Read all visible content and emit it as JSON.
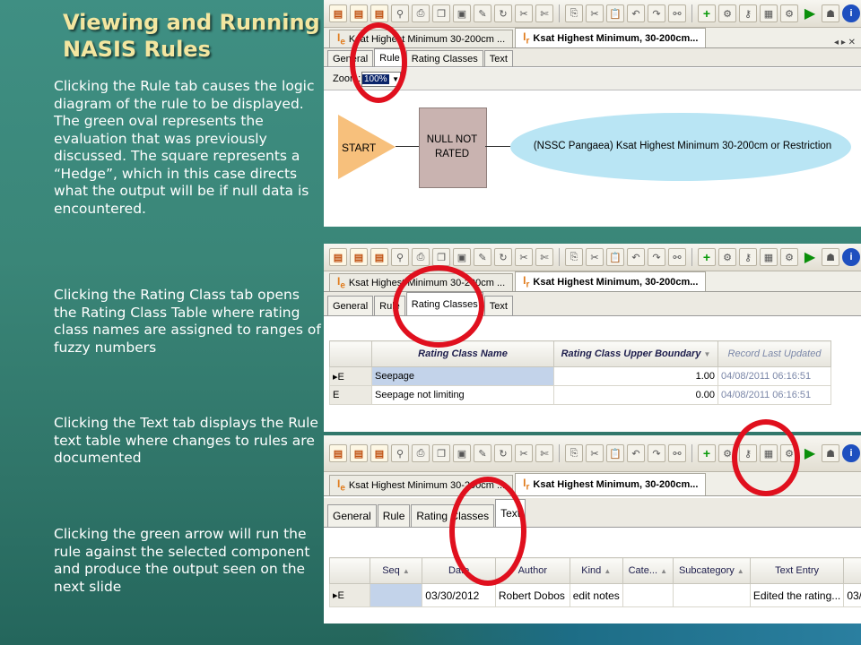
{
  "slide": {
    "title": "Viewing and Running NASIS Rules",
    "paragraphs": [
      "Clicking the Rule tab causes the logic diagram of the rule to be displayed. The green oval represents the evaluation that was previously discussed. The square represents a “Hedge”, which in this case directs what the output will be if null data is encountered.",
      "Clicking the Rating Class tab opens the Rating Class Table where rating class names are assigned to ranges of fuzzy numbers",
      "Clicking the Text tab displays the Rule text table where changes to rules are documented",
      "Clicking the green arrow will run the rule against the selected component and produce the output seen on the next slide"
    ]
  },
  "doc_tabs": {
    "inactive": "Ksat Highest Minimum 30-200cm ...",
    "active": "Ksat Highest Minimum, 30-200cm...",
    "inactive_icon": "I",
    "inactive_icon_sub": "e",
    "active_icon": "I",
    "active_icon_sub": "r"
  },
  "sub_tabs": [
    "General",
    "Rule",
    "Rating Classes",
    "Text"
  ],
  "rule_view": {
    "zoom_label": "Zoom:",
    "zoom_value": "100%",
    "start": "START",
    "hedge": [
      "NULL NOT",
      "RATED"
    ],
    "evaluation": "(NSSC Pangaea) Ksat Highest Minimum 30-200cm or Restriction"
  },
  "rating_classes": {
    "columns": [
      "Rating Class Name",
      "Rating Class Upper Boundary",
      "Record Last Updated"
    ],
    "rows": [
      {
        "marker": "E",
        "name": "Seepage",
        "upper": "1.00",
        "updated": "04/08/2011 06:16:51"
      },
      {
        "marker": "E",
        "name": "Seepage not limiting",
        "upper": "0.00",
        "updated": "04/08/2011 06:16:51"
      }
    ]
  },
  "text_table": {
    "columns": [
      "Seq",
      "Date",
      "Author",
      "Kind",
      "Cate...",
      "Subcategory",
      "Text Entry"
    ],
    "row": {
      "marker": "E",
      "seq": "",
      "date": "03/30/2012",
      "author": "Robert Dobos",
      "kind": "edit notes",
      "cate": "",
      "subcategory": "",
      "text": "Edited the rating...",
      "extra": "03/"
    }
  },
  "colors": {
    "title": "#f3e6a0",
    "highlight_ring": "#e0101e",
    "oval": "#b9e5f4",
    "hedge": "#c9b3b0",
    "start": "#f7c07c",
    "run_arrow": "#0a8f0a"
  },
  "icons": [
    "new-document-icon",
    "open-document-icon",
    "query-icon",
    "filter-icon",
    "print-icon",
    "save-icon",
    "edit-icon",
    "refresh-icon",
    "cut-icon",
    "copy-icon",
    "paste-icon",
    "undo-icon",
    "redo-icon",
    "find-icon",
    "add-icon",
    "properties-icon",
    "run-rule-icon",
    "help-icon"
  ]
}
